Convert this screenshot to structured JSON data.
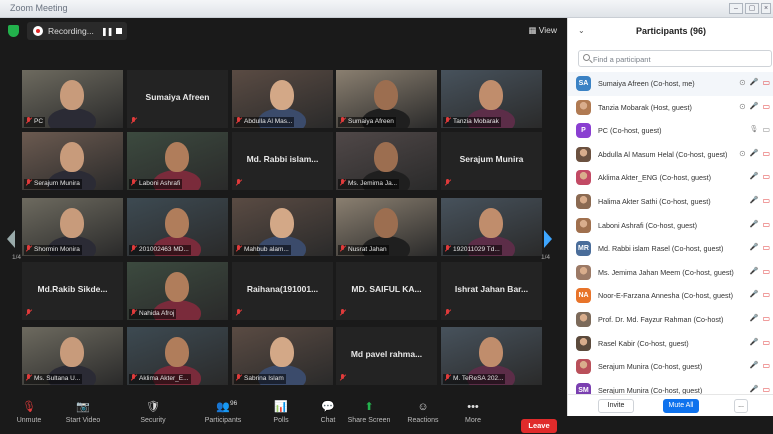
{
  "window": {
    "title": "Zoom Meeting"
  },
  "topbar": {
    "recording_label": "Recording...",
    "view_label": "View"
  },
  "colors": {
    "accent": "#3ea6ff",
    "leave": "#e02b2b",
    "active_speaker": "#b9e25b",
    "muted": "#e03b3b"
  },
  "pager": {
    "left": "1/4",
    "right": "1/4"
  },
  "tiles": [
    {
      "name": "",
      "caption": "PC",
      "video": true
    },
    {
      "name": "Sumaiya Afreen",
      "caption": "",
      "video": false
    },
    {
      "name": "",
      "caption": "Abdulla Al Mas...",
      "video": true
    },
    {
      "name": "",
      "caption": "Sumaiya Afreen",
      "video": true
    },
    {
      "name": "",
      "caption": "Tanzia Mobarak",
      "video": true
    },
    {
      "name": "",
      "caption": "Serajum Munira",
      "video": true
    },
    {
      "name": "",
      "caption": "Laboni Ashrafi",
      "video": true
    },
    {
      "name": "Md. Rabbi islam...",
      "caption": "",
      "video": false
    },
    {
      "name": "",
      "caption": "Ms. Jemima Ja...",
      "video": true
    },
    {
      "name": "Serajum Munira",
      "caption": "",
      "video": false
    },
    {
      "name": "",
      "caption": "Shormin Monira",
      "video": true
    },
    {
      "name": "",
      "caption": "201002463 MD...",
      "video": true
    },
    {
      "name": "",
      "caption": "Mahbub alam...",
      "video": true
    },
    {
      "name": "",
      "caption": "Nusrat Jahan",
      "video": true
    },
    {
      "name": "",
      "caption": "192011029 Td...",
      "video": true
    },
    {
      "name": "Md.Rakib Sikde...",
      "caption": "",
      "video": false
    },
    {
      "name": "",
      "caption": "Nahida Afroj",
      "video": true
    },
    {
      "name": "Raihana(191001...",
      "caption": "",
      "video": false
    },
    {
      "name": "MD. SAIFUL KA...",
      "caption": "",
      "video": false
    },
    {
      "name": "Ishrat Jahan Bar...",
      "caption": "",
      "video": false
    },
    {
      "name": "",
      "caption": "Ms. Sultana U...",
      "video": true
    },
    {
      "name": "",
      "caption": "Aklima Akter_E...",
      "video": true
    },
    {
      "name": "",
      "caption": "Sabrina Islam",
      "video": true
    },
    {
      "name": "Md pavel rahma...",
      "caption": "",
      "video": false
    },
    {
      "name": "",
      "caption": "M. TeReSA 202...",
      "video": true
    }
  ],
  "toolbar": {
    "items": [
      {
        "label": "Unmute",
        "icon": "microphone-muted-icon"
      },
      {
        "label": "Start Video",
        "icon": "video-off-icon"
      },
      {
        "label": "Security",
        "icon": "shield-icon"
      },
      {
        "label": "Participants",
        "icon": "participants-icon",
        "count": "96"
      },
      {
        "label": "Polls",
        "icon": "polls-icon"
      },
      {
        "label": "Chat",
        "icon": "chat-icon"
      },
      {
        "label": "Share Screen",
        "icon": "share-screen-icon"
      },
      {
        "label": "Reactions",
        "icon": "reactions-icon"
      },
      {
        "label": "More",
        "icon": "more-icon"
      }
    ],
    "leave_label": "Leave"
  },
  "panel": {
    "title": "Participants (96)",
    "search_placeholder": "Find a participant",
    "participants": [
      {
        "initials": "SA",
        "color": "#3b82c4",
        "photo": false,
        "name": "Sumaiya Afreen (Co-host, me)"
      },
      {
        "initials": "",
        "color": "#b07a52",
        "photo": true,
        "name": "Tanzia Mobarak (Host, guest)"
      },
      {
        "initials": "P",
        "color": "#8a3fd1",
        "photo": false,
        "name": "PC (Co-host, guest)"
      },
      {
        "initials": "",
        "color": "#6b5140",
        "photo": true,
        "name": "Abdulla Al Masum Helal (Co-host, guest)"
      },
      {
        "initials": "",
        "color": "#c24a64",
        "photo": true,
        "name": "Aklima Akter_ENG (Co-host, guest)"
      },
      {
        "initials": "",
        "color": "#8b6a52",
        "photo": true,
        "name": "Halima Akter Sathi (Co-host, guest)"
      },
      {
        "initials": "",
        "color": "#a0704e",
        "photo": true,
        "name": "Laboni Ashrafi (Co-host, guest)"
      },
      {
        "initials": "MR",
        "color": "#4a6d9a",
        "photo": false,
        "name": "Md. Rabbi islam Rasel (Co-host, guest)"
      },
      {
        "initials": "",
        "color": "#9c7a66",
        "photo": true,
        "name": "Ms. Jemima Jahan Meem (Co-host, guest)"
      },
      {
        "initials": "NA",
        "color": "#e8742a",
        "photo": false,
        "name": "Noor-E-Farzana Annesha (Co-host, guest)"
      },
      {
        "initials": "",
        "color": "#7c6a5a",
        "photo": true,
        "name": "Prof. Dr. Md. Fayzur Rahman (Co-host)"
      },
      {
        "initials": "",
        "color": "#5b4a3c",
        "photo": true,
        "name": "Rasel Kabir (Co-host, guest)"
      },
      {
        "initials": "",
        "color": "#b9505a",
        "photo": true,
        "name": "Serajum Munira (Co-host, guest)"
      },
      {
        "initials": "SM",
        "color": "#7a3fb0",
        "photo": false,
        "name": "Serajum Munira (Co-host, guest)"
      }
    ],
    "invite_label": "Invite",
    "mute_all_label": "Mute All",
    "more_label": "..."
  }
}
